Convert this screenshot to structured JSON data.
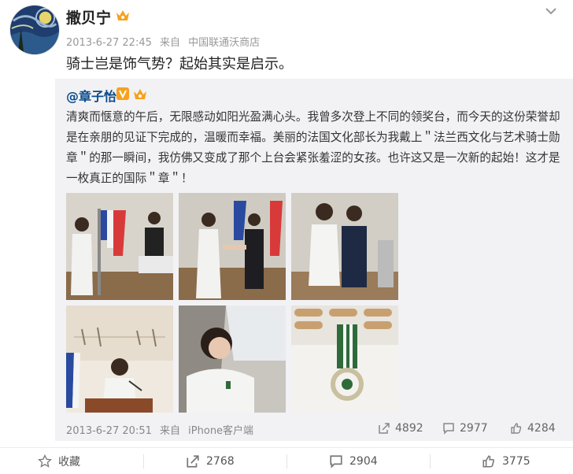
{
  "post": {
    "username": "撒贝宁",
    "time": "2013-6-27 22:45",
    "via": "来自",
    "source": "中国联通沃商店",
    "text": "骑士岂是饰气势？起始其实是启示。"
  },
  "repost": {
    "author": "@章子怡",
    "text": "清爽而惬意的午后，无限感动如阳光盈满心头。我曾多次登上不同的领奖台，而今天的这份荣誉却是在亲朋的见证下完成的，温暖而幸福。美丽的法国文化部长为我戴上＂法兰西文化与艺术骑士勋章＂的那一瞬间，我仿佛又变成了那个上台会紧张羞涩的女孩。也许这又是一次新的起始！这才是一枚真正的国际＂章＂！",
    "time": "2013-6-27 20:51",
    "via": "来自",
    "source": "iPhone客户端",
    "reposts": "4892",
    "comments": "2977",
    "likes": "4284"
  },
  "actions": {
    "favorite": "收藏",
    "repost": "2768",
    "comment": "2904",
    "like": "3775"
  },
  "icons": {
    "avatar": "starry-night-avatar",
    "vip": "vip-crown-icon",
    "verified": "verified-v-icon",
    "menu": "chevron-down-icon"
  },
  "colors": {
    "link": "#0b4b8a",
    "repost_bg": "#f2f2f5",
    "meta": "#999999",
    "verified": "#f6a21e"
  }
}
